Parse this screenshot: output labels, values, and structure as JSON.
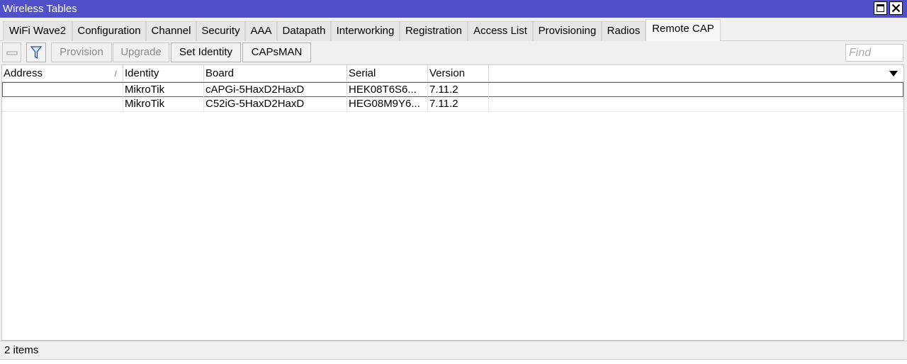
{
  "window": {
    "title": "Wireless Tables"
  },
  "tabs": [
    {
      "label": "WiFi Wave2",
      "active": false
    },
    {
      "label": "Configuration",
      "active": false
    },
    {
      "label": "Channel",
      "active": false
    },
    {
      "label": "Security",
      "active": false
    },
    {
      "label": "AAA",
      "active": false
    },
    {
      "label": "Datapath",
      "active": false
    },
    {
      "label": "Interworking",
      "active": false
    },
    {
      "label": "Registration",
      "active": false
    },
    {
      "label": "Access List",
      "active": false
    },
    {
      "label": "Provisioning",
      "active": false
    },
    {
      "label": "Radios",
      "active": false
    },
    {
      "label": "Remote CAP",
      "active": true
    }
  ],
  "toolbar": {
    "remove_icon": "minus-icon",
    "filter_icon": "filter-icon",
    "provision_label": "Provision",
    "upgrade_label": "Upgrade",
    "set_identity_label": "Set Identity",
    "capsman_label": "CAPsMAN",
    "find_placeholder": "Find"
  },
  "table": {
    "columns": [
      "Address",
      "Identity",
      "Board",
      "Serial",
      "Version"
    ],
    "sort_indicator": "/",
    "rows": [
      {
        "address": "",
        "identity": "MikroTik",
        "board": "cAPGi-5HaxD2HaxD",
        "serial": "HEK08T6S6...",
        "version": "7.11.2"
      },
      {
        "address": "",
        "identity": "MikroTik",
        "board": "C52iG-5HaxD2HaxD",
        "serial": "HEG08M9Y6...",
        "version": "7.11.2"
      }
    ]
  },
  "status": {
    "count": "2 items"
  },
  "colors": {
    "titlebar": "#5050c8",
    "background": "#f0f0f0"
  }
}
